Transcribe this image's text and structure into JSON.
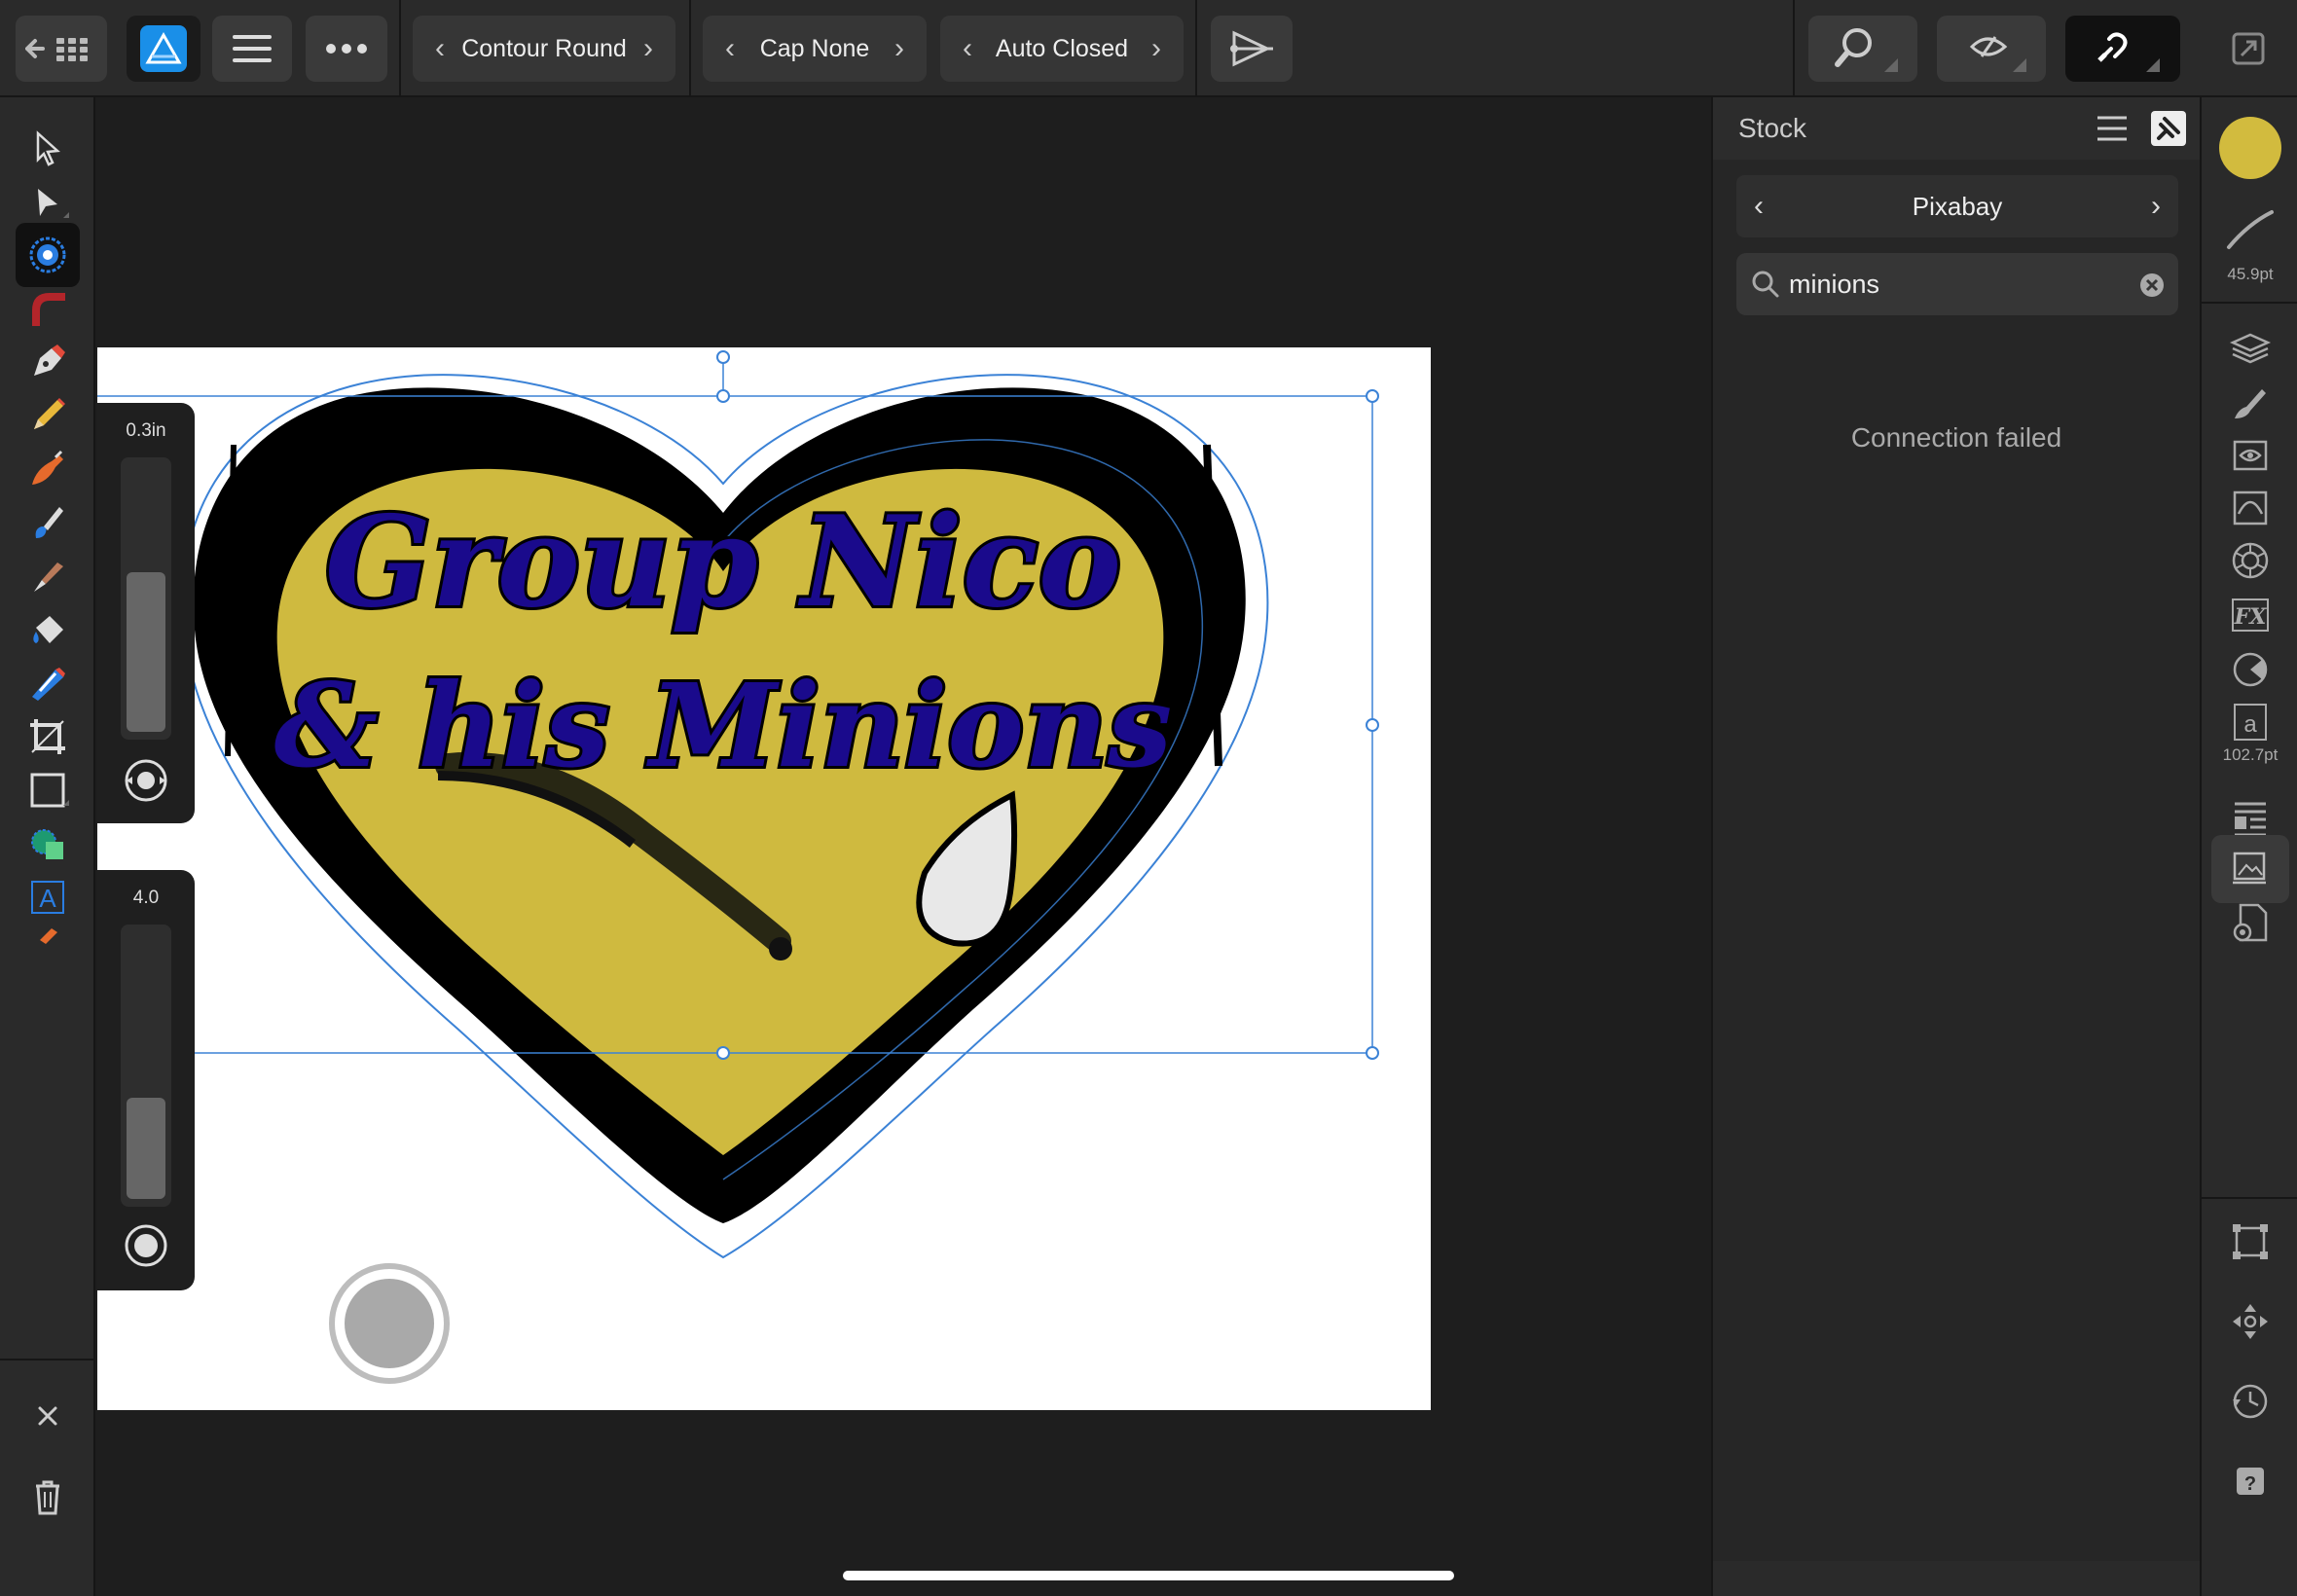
{
  "toolbar": {
    "contour": "Contour Round",
    "cap": "Cap None",
    "closed": "Auto Closed"
  },
  "artwork": {
    "line1": "Group Nico",
    "line2": "& his Minions",
    "fill_color": "#cfba3f",
    "text_color": "#1a0a8c"
  },
  "sliders": {
    "width_label": "0.3in",
    "width_fraction": 0.6,
    "second_label": "4.0",
    "second_fraction": 0.38
  },
  "stock": {
    "title": "Stock",
    "source": "Pixabay",
    "search_value": "minions",
    "status": "Connection failed"
  },
  "studio": {
    "stroke_size": "45.9pt",
    "text_size": "102.7pt",
    "color_swatch": "#d2bb3e"
  },
  "colors": {
    "accent_blue": "#2a7de1",
    "selection_blue": "#3b82d6"
  }
}
